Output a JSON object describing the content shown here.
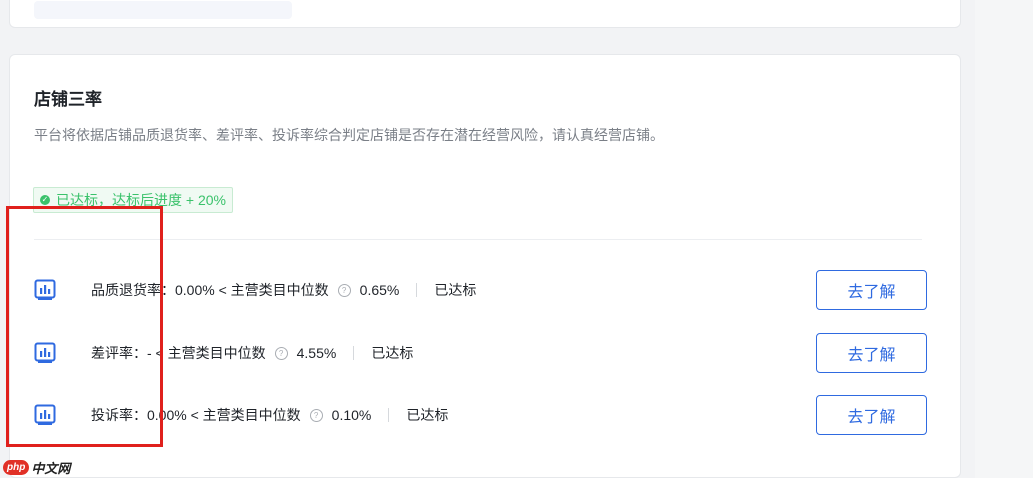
{
  "section": {
    "title": "店铺三率",
    "description": "平台将依据店铺品质退货率、差评率、投诉率综合判定店铺是否存在潜在经营风险，请认真经营店铺。",
    "badge": "已达标，达标后进度 + 20%"
  },
  "metrics": [
    {
      "label": "品质退货率：0.00% < 主营类目中位数",
      "value": "0.65%",
      "status": "已达标",
      "button": "去了解"
    },
    {
      "label": "差评率：- < 主营类目中位数",
      "value": "4.55%",
      "status": "已达标",
      "button": "去了解"
    },
    {
      "label": "投诉率：0.00% < 主营类目中位数",
      "value": "0.10%",
      "status": "已达标",
      "button": "去了解"
    }
  ],
  "help_glyph": "?",
  "watermark": {
    "logo": "php",
    "text": "中文网"
  },
  "colors": {
    "accent": "#2f6ae0",
    "success": "#3ac26b",
    "highlight": "#e0201c"
  }
}
